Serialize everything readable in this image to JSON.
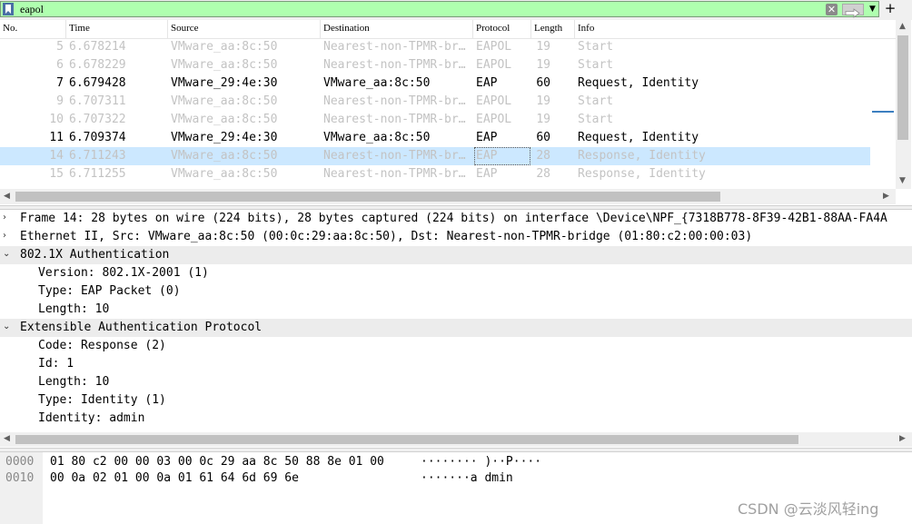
{
  "filter": {
    "value": "eapol",
    "clear_glyph": "✕",
    "dropdown_glyph": "▼",
    "add_glyph": "+"
  },
  "columns": [
    "No.",
    "Time",
    "Source",
    "Destination",
    "Protocol",
    "Length",
    "Info"
  ],
  "packets": [
    {
      "no": "5",
      "time": "6.678214",
      "src": "VMware_aa:8c:50",
      "dst": "Nearest-non-TPMR-br…",
      "proto": "EAPOL",
      "len": "19",
      "info": "Start",
      "ignored": true
    },
    {
      "no": "6",
      "time": "6.678229",
      "src": "VMware_aa:8c:50",
      "dst": "Nearest-non-TPMR-br…",
      "proto": "EAPOL",
      "len": "19",
      "info": "Start",
      "ignored": true
    },
    {
      "no": "7",
      "time": "6.679428",
      "src": "VMware_29:4e:30",
      "dst": "VMware_aa:8c:50",
      "proto": "EAP",
      "len": "60",
      "info": "Request, Identity",
      "ignored": false
    },
    {
      "no": "9",
      "time": "6.707311",
      "src": "VMware_aa:8c:50",
      "dst": "Nearest-non-TPMR-br…",
      "proto": "EAPOL",
      "len": "19",
      "info": "Start",
      "ignored": true
    },
    {
      "no": "10",
      "time": "6.707322",
      "src": "VMware_aa:8c:50",
      "dst": "Nearest-non-TPMR-br…",
      "proto": "EAPOL",
      "len": "19",
      "info": "Start",
      "ignored": true
    },
    {
      "no": "11",
      "time": "6.709374",
      "src": "VMware_29:4e:30",
      "dst": "VMware_aa:8c:50",
      "proto": "EAP",
      "len": "60",
      "info": "Request, Identity",
      "ignored": false
    },
    {
      "no": "14",
      "time": "6.711243",
      "src": "VMware_aa:8c:50",
      "dst": "Nearest-non-TPMR-br…",
      "proto": "EAP",
      "len": "28",
      "info": "Response, Identity",
      "ignored": true,
      "selected": true
    },
    {
      "no": "15",
      "time": "6.711255",
      "src": "VMware_aa:8c:50",
      "dst": "Nearest-non-TPMR-br…",
      "proto": "EAP",
      "len": "28",
      "info": "Response, Identity",
      "ignored": true
    }
  ],
  "details": [
    {
      "toggle": "›",
      "indent": 0,
      "text": "Frame 14: 28 bytes on wire (224 bits), 28 bytes captured (224 bits) on interface \\Device\\NPF_{7318B778-8F39-42B1-88AA-FA4A"
    },
    {
      "toggle": "›",
      "indent": 0,
      "text": "Ethernet II, Src: VMware_aa:8c:50 (00:0c:29:aa:8c:50), Dst: Nearest-non-TPMR-bridge (01:80:c2:00:00:03)"
    },
    {
      "toggle": "⌄",
      "indent": 0,
      "text": "802.1X Authentication",
      "open": true
    },
    {
      "toggle": "",
      "indent": 1,
      "text": "Version: 802.1X-2001 (1)"
    },
    {
      "toggle": "",
      "indent": 1,
      "text": "Type: EAP Packet (0)"
    },
    {
      "toggle": "",
      "indent": 1,
      "text": "Length: 10"
    },
    {
      "toggle": "⌄",
      "indent": 0,
      "text": "Extensible Authentication Protocol",
      "open": true
    },
    {
      "toggle": "",
      "indent": 1,
      "text": "Code: Response (2)"
    },
    {
      "toggle": "",
      "indent": 1,
      "text": "Id: 1"
    },
    {
      "toggle": "",
      "indent": 1,
      "text": "Length: 10"
    },
    {
      "toggle": "",
      "indent": 1,
      "text": "Type: Identity (1)"
    },
    {
      "toggle": "",
      "indent": 1,
      "text": "Identity: admin"
    }
  ],
  "hex": [
    {
      "offset": "0000",
      "bytes": "01 80 c2 00 00 03 00 0c  29 aa 8c 50 88 8e 01 00",
      "ascii": "········ )··P····"
    },
    {
      "offset": "0010",
      "bytes": "00 0a 02 01 00 0a 01 61  64 6d 69 6e",
      "ascii": "·······a dmin"
    }
  ],
  "watermark": "CSDN @云淡风轻ing",
  "colors": {
    "filter_ok": "#afffaf",
    "selected_row": "#cce8ff",
    "ignored_text": "#c3c3c3"
  }
}
